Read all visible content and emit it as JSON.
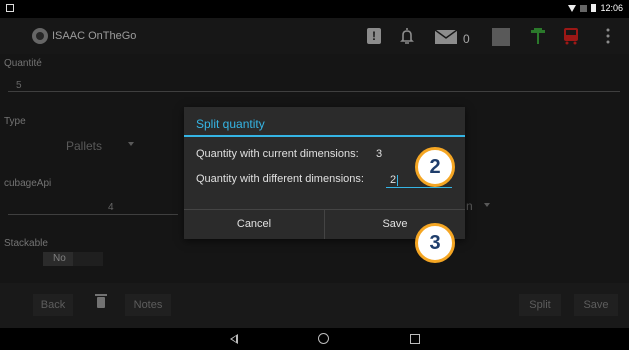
{
  "status_bar": {
    "time": "12:06"
  },
  "action_bar": {
    "app_title": "ISAAC OnTheGo",
    "mail_count": "0",
    "alert_glyph": "!"
  },
  "form": {
    "quantite_label": "Quantité",
    "quantite_value": "5",
    "type_label": "Type",
    "type_value": "Pallets",
    "cubage_label": "cubageApi",
    "cubage_value": "4",
    "cubage_right_value": "n",
    "stackable_label": "Stackable",
    "stackable_value": "No"
  },
  "toolbar": {
    "back": "Back",
    "notes": "Notes",
    "split": "Split",
    "save": "Save"
  },
  "dialog": {
    "title": "Split quantity",
    "current_label": "Quantity with current dimensions:",
    "current_value": "3",
    "different_label": "Quantity with different dimensions:",
    "different_value": "2",
    "cancel": "Cancel",
    "save": "Save"
  },
  "callouts": {
    "first": "2",
    "second": "3"
  },
  "colors": {
    "accent": "#35b5e5",
    "callout_border": "#f5a623",
    "callout_text": "#1f3d6b"
  },
  "icons": [
    "alert-icon",
    "bell-icon",
    "mail-icon",
    "edit-icon",
    "palm-tree-icon",
    "bus-icon",
    "overflow-menu-icon",
    "trash-icon",
    "nav-back-icon",
    "nav-home-icon",
    "nav-recent-icon"
  ]
}
